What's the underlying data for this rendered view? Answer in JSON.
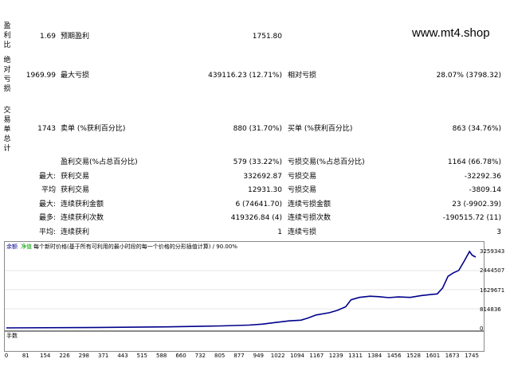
{
  "watermark": "www.mt4.shop",
  "rows": {
    "r1": {
      "side_label": "盈利比",
      "left_value": "1.69",
      "label1": "预期盈利",
      "value1": "1751.80"
    },
    "r2": {
      "side_label": "绝对亏损",
      "left_value": "1969.99",
      "label1": "最大亏损",
      "value1": "439116.23 (12.71%)",
      "label2": "相对亏损",
      "value2": "28.07% (3798.32)"
    },
    "r3": {
      "side_label": "交易单总计",
      "left_value": "1743",
      "label1": "卖单 (%获利百分比)",
      "value1": "880 (31.70%)",
      "label2": "买单 (%获利百分比)",
      "value2": "863 (34.76%)"
    },
    "r4": {
      "label1": "盈利交易(%占总百分比)",
      "value1": "579 (33.22%)",
      "label2": "亏损交易(%占总百分比)",
      "value2": "1164 (66.78%)"
    },
    "r5": {
      "prefix": "最大:",
      "label1": "获利交易",
      "value1": "332692.87",
      "label2": "亏损交易",
      "value2": "-32292.36"
    },
    "r6": {
      "prefix": "平均",
      "label1": "获利交易",
      "value1": "12931.30",
      "label2": "亏损交易",
      "value2": "-3809.14"
    },
    "r7": {
      "prefix": "最大:",
      "label1": "连续获利金额",
      "value1": "6 (74641.70)",
      "label2": "连续亏损金额",
      "value2": "23 (-9902.39)"
    },
    "r8": {
      "prefix": "最多:",
      "label1": "连续获利次数",
      "value1": "419326.84 (4)",
      "label2": "连续亏损次数",
      "value2": "-190515.72 (11)"
    },
    "r9": {
      "prefix": "平均:",
      "label1": "连续获利",
      "value1": "1",
      "label2": "连续亏损",
      "value2": "3"
    }
  },
  "chart": {
    "legend_balance": "余额",
    "legend_equity": "净值",
    "legend_text": "每个新时价格(基于所有可利用的最小时段的每一个价格的分形插值计算) / 90.00%",
    "volume_label": "手数",
    "balance_color": "#00008b",
    "volume_color": "#00b000",
    "y_ticks": [
      "3259343",
      "2444507",
      "1629671",
      "814836",
      "0"
    ],
    "x_ticks": [
      "0",
      "81",
      "154",
      "226",
      "298",
      "371",
      "443",
      "515",
      "588",
      "660",
      "732",
      "805",
      "877",
      "949",
      "1022",
      "1094",
      "1167",
      "1239",
      "1311",
      "1384",
      "1456",
      "1528",
      "1601",
      "1673",
      "1745"
    ]
  },
  "chart_data": {
    "type": "line",
    "title": "",
    "xlabel": "",
    "ylabel": "",
    "xlim": [
      0,
      1743
    ],
    "ylim": [
      0,
      3259343
    ],
    "series": [
      {
        "name": "余额",
        "x": [
          0,
          300,
          600,
          800,
          900,
          950,
          1000,
          1050,
          1094,
          1120,
          1150,
          1200,
          1230,
          1260,
          1280,
          1311,
          1350,
          1384,
          1420,
          1456,
          1500,
          1540,
          1580,
          1600,
          1620,
          1640,
          1660,
          1680,
          1700,
          1720,
          1730,
          1743
        ],
        "y": [
          0,
          15000,
          45000,
          85000,
          120000,
          160000,
          230000,
          300000,
          330000,
          420000,
          550000,
          650000,
          750000,
          900000,
          1200000,
          1300000,
          1350000,
          1330000,
          1290000,
          1320000,
          1300000,
          1380000,
          1430000,
          1450000,
          1700000,
          2200000,
          2350000,
          2450000,
          2850000,
          3259343,
          3100000,
          3020000
        ]
      }
    ]
  }
}
